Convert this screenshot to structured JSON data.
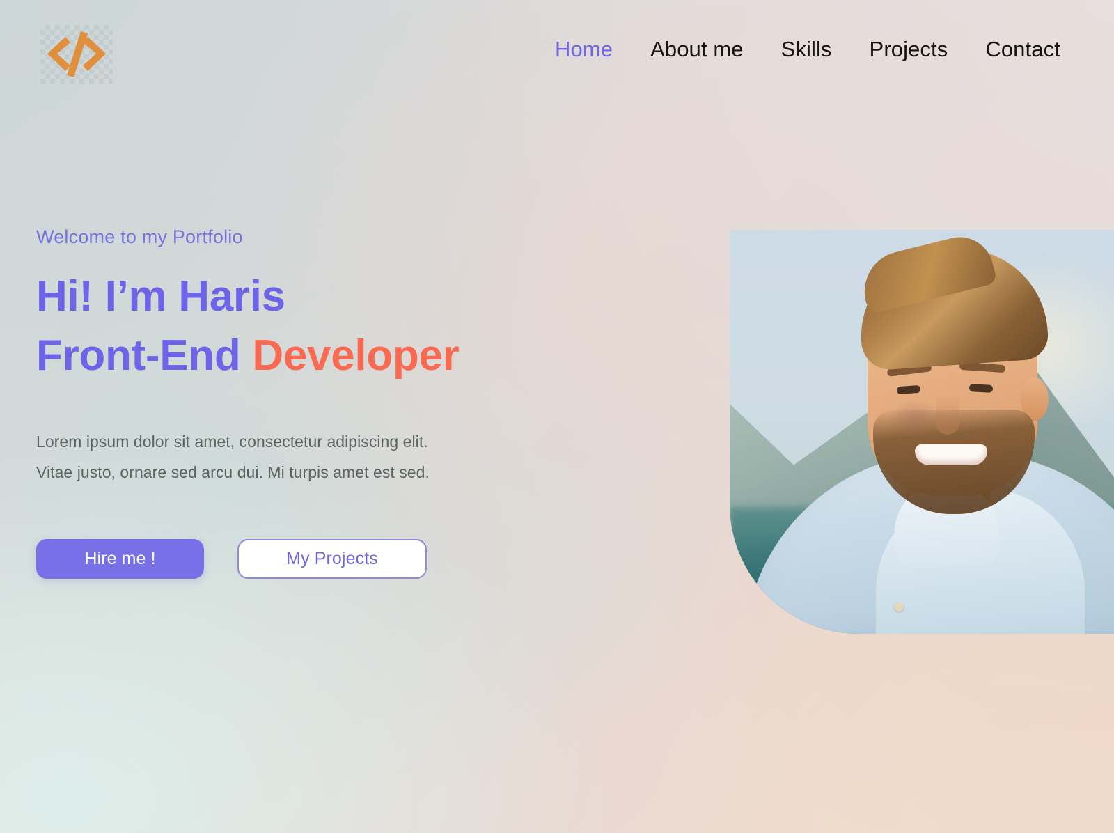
{
  "brand": {
    "logo_icon": "code-brackets-icon",
    "logo_alt": "</>",
    "logo_color": "#e0903c"
  },
  "nav": {
    "items": [
      {
        "label": "Home",
        "active": true
      },
      {
        "label": "About  me",
        "active": false
      },
      {
        "label": "Skills",
        "active": false
      },
      {
        "label": "Projects",
        "active": false
      },
      {
        "label": "Contact",
        "active": false
      }
    ]
  },
  "hero": {
    "eyebrow": "Welcome to my Portfolio",
    "headline_line1": "Hi! I’m Haris",
    "headline_line2_primary": "Front-End ",
    "headline_line2_accent": "Developer",
    "paragraph_line1": "Lorem ipsum dolor sit amet, consectetur adipiscing elit.",
    "paragraph_line2": "Vitae justo, ornare sed arcu dui. Mi turpis amet est sed.",
    "primary_button": "Hire me !",
    "secondary_button": "My Projects",
    "portrait_alt": "Smiling bearded man in light blue shirt with mountains behind"
  },
  "colors": {
    "purple": "#6d64e7",
    "purple_soft": "#7a72dc",
    "purple_button": "#7870e6",
    "coral": "#f96a52",
    "body_text": "#5b6461",
    "nav_text": "#16140f",
    "background_cool": "#cdd6d8",
    "background_warm": "#f0dccc",
    "background_mint": "#ddeeea"
  }
}
